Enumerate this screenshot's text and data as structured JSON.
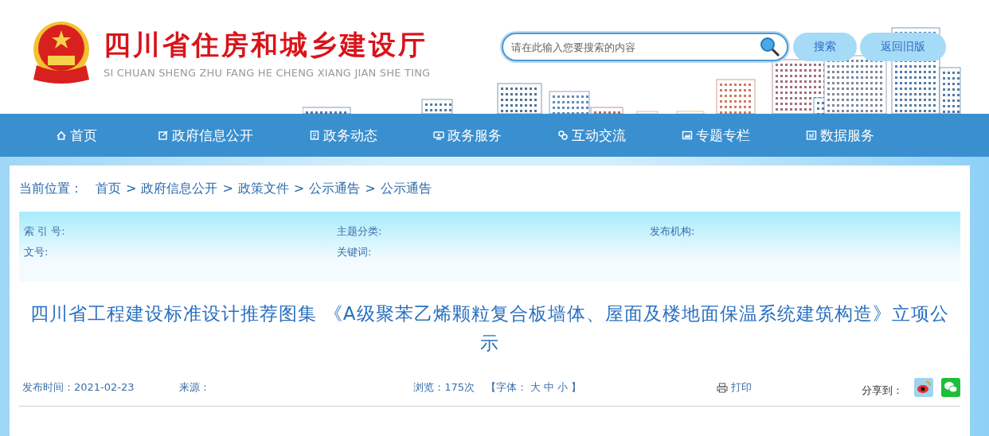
{
  "header": {
    "title": "四川省住房和城乡建设厅",
    "subtitle": "SI CHUAN SHENG ZHU FANG HE CHENG XIANG JIAN SHE TING",
    "search": {
      "placeholder": "请在此输入您要搜索的内容"
    },
    "buttons": [
      "搜索",
      "返回旧版"
    ]
  },
  "nav": [
    {
      "label": "首页"
    },
    {
      "label": "政府信息公开"
    },
    {
      "label": "政务动态"
    },
    {
      "label": "政务服务"
    },
    {
      "label": "互动交流"
    },
    {
      "label": "专题专栏"
    },
    {
      "label": "数据服务"
    }
  ],
  "breadcrumb": {
    "label": "当前位置：",
    "items": [
      "首页",
      "政府信息公开",
      "政策文件",
      "公示通告",
      "公示通告"
    ],
    "separator": ">"
  },
  "info_fields": [
    {
      "label": "索 引 号:"
    },
    {
      "label": "主题分类:"
    },
    {
      "label": "发布机构:"
    },
    {
      "label": "文号:"
    },
    {
      "label": "关键词:"
    }
  ],
  "article": {
    "title": "四川省工程建设标准设计推荐图集 《A级聚苯乙烯颗粒复合板墙体、屋面及楼地面保温系统建筑构造》立项公示"
  },
  "meta": {
    "publish_time": "发布时间：2021-02-23",
    "source": "来源：",
    "views": "浏览：175次",
    "font_open": "【字体：",
    "font_sizes": [
      "大",
      "中",
      "小"
    ],
    "font_close": "】",
    "print": "打印",
    "share_label": "分享到："
  }
}
